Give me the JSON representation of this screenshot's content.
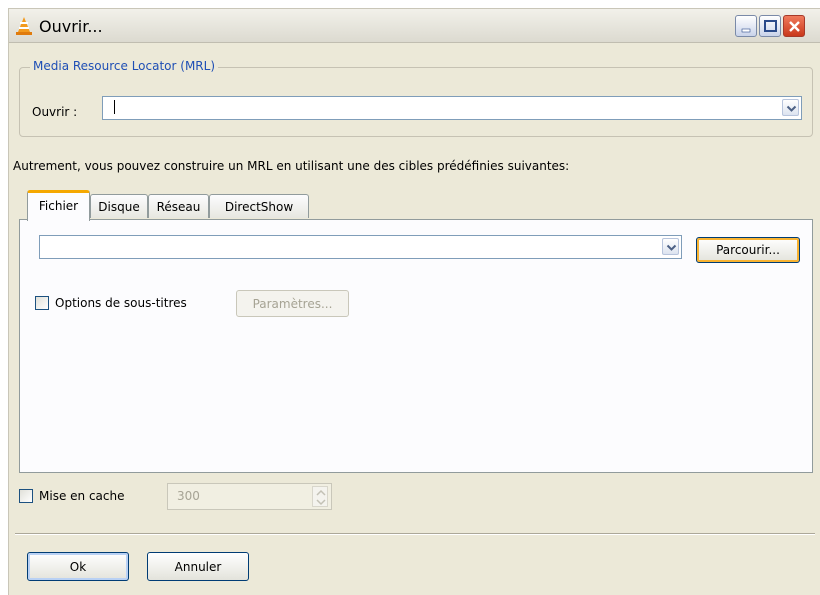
{
  "window": {
    "title": "Ouvrir..."
  },
  "mrl": {
    "legend": "Media Resource Locator (MRL)",
    "open_label": "Ouvrir :",
    "open_value": ""
  },
  "hint": "Autrement, vous pouvez construire un MRL en utilisant une des cibles prédéfinies suivantes:",
  "tabs": [
    {
      "label": "Fichier",
      "active": true
    },
    {
      "label": "Disque"
    },
    {
      "label": "Réseau"
    },
    {
      "label": "DirectShow"
    }
  ],
  "file_tab": {
    "file_value": "",
    "browse_label": "Parcourir...",
    "subtitles_label": "Options de sous-titres",
    "subtitles_checked": false,
    "params_label": "Paramètres..."
  },
  "cache": {
    "label": "Mise en cache",
    "checked": false,
    "value": "300"
  },
  "footer": {
    "ok_label": "Ok",
    "cancel_label": "Annuler"
  }
}
